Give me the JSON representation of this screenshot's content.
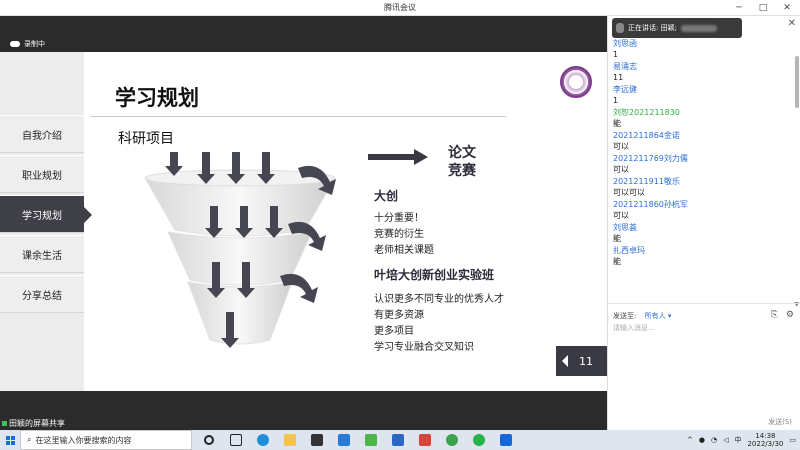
{
  "window": {
    "title": "腾讯会议"
  },
  "recording": {
    "label": "录制中"
  },
  "sidebar": {
    "items": [
      {
        "label": "自我介绍",
        "active": false
      },
      {
        "label": "职业规划",
        "active": false
      },
      {
        "label": "学习规划",
        "active": true
      },
      {
        "label": "课余生活",
        "active": false
      },
      {
        "label": "分享总结",
        "active": false
      }
    ]
  },
  "slide": {
    "title": "学习规划",
    "section": "科研项目",
    "right_label": [
      "论文",
      "竞赛"
    ],
    "block1": {
      "head": "大创",
      "lines": [
        "十分重要！",
        "竞赛的衍生",
        "老师相关课题"
      ]
    },
    "block2": {
      "head": "叶培大创新创业实验班",
      "lines": [
        "认识更多不同专业的优秀人才",
        "有更多资源",
        "更多项目",
        "学习专业融合交叉知识"
      ]
    },
    "page_number": "11"
  },
  "share": {
    "label": "田颖的屏幕共享"
  },
  "chat": {
    "speaking_label": "正在讲话: 田颖;",
    "messages": [
      {
        "kind": "name",
        "text": "刘思函"
      },
      {
        "kind": "text",
        "text": "1"
      },
      {
        "kind": "name",
        "text": "易涌志"
      },
      {
        "kind": "text",
        "text": "11"
      },
      {
        "kind": "name",
        "text": "李远健"
      },
      {
        "kind": "text",
        "text": "1"
      },
      {
        "kind": "name",
        "color": "green",
        "text": "刘恕2021211830"
      },
      {
        "kind": "text",
        "text": "能"
      },
      {
        "kind": "name",
        "text": "2021211864金诺"
      },
      {
        "kind": "text",
        "text": "可以"
      },
      {
        "kind": "name",
        "text": "2021211769刘力儒"
      },
      {
        "kind": "text",
        "text": "可以"
      },
      {
        "kind": "name",
        "text": "2021211911敬乐"
      },
      {
        "kind": "text",
        "text": "可以可以"
      },
      {
        "kind": "name",
        "text": "2021211860孙杭军"
      },
      {
        "kind": "text",
        "text": "可以"
      },
      {
        "kind": "name",
        "text": "刘思荟"
      },
      {
        "kind": "text",
        "text": "能"
      },
      {
        "kind": "name",
        "text": "扎西卓玛"
      },
      {
        "kind": "text",
        "text": "能"
      }
    ],
    "send_to_label": "发送至:",
    "send_to_value": "所有人 ▾",
    "input_placeholder": "请输入消息...",
    "send_button": "发送(S)"
  },
  "taskbar": {
    "search_placeholder": "在这里输入你要搜索的内容",
    "tray_lang": "中",
    "time": "14:38",
    "date": "2022/3/30"
  }
}
